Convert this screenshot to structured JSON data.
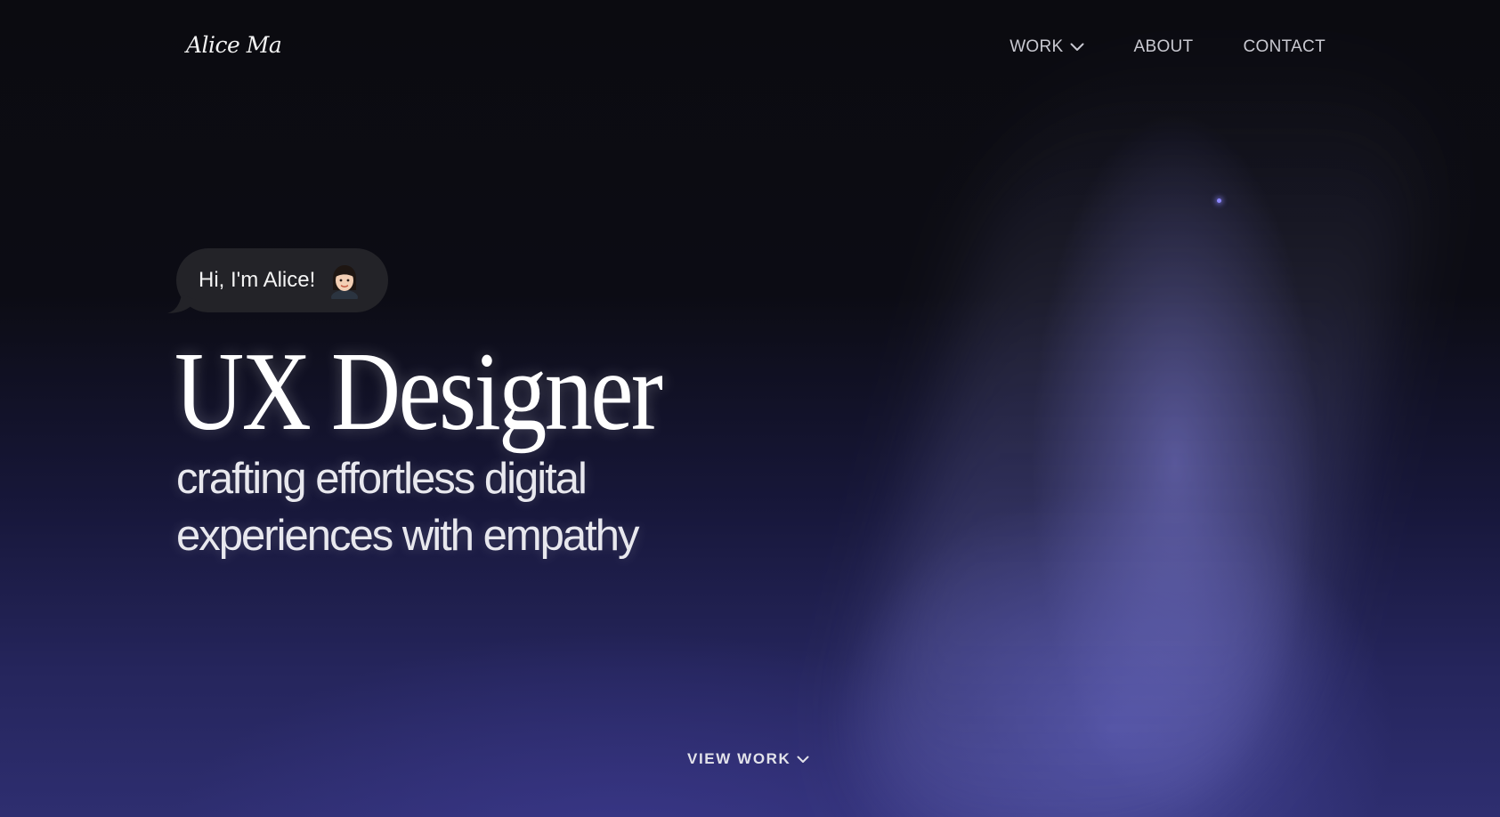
{
  "header": {
    "logo": "Alice Ma",
    "nav": [
      {
        "label": "WORK",
        "has_dropdown": true,
        "icon": "chevron-down-icon"
      },
      {
        "label": "ABOUT"
      },
      {
        "label": "CONTACT"
      }
    ]
  },
  "hero": {
    "greeting": "Hi, I'm Alice!",
    "avatar_icon": "memoji-avatar",
    "title": "UX Designer",
    "subtitle_lines": [
      "crafting effortless digital",
      "experiences with empathy"
    ]
  },
  "cta": {
    "label": "VIEW WORK",
    "icon": "chevron-down-icon"
  },
  "colors": {
    "background": "#0b0b10",
    "accent_glow": "#5a5ac0",
    "bubble": "#232328",
    "text": "#ffffff"
  }
}
